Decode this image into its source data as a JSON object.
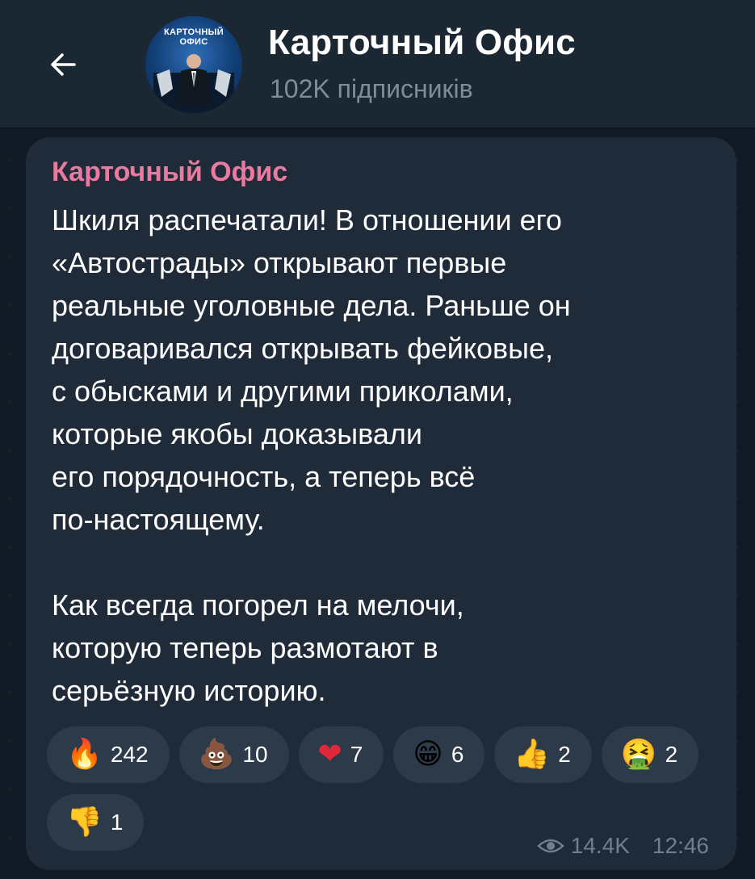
{
  "header": {
    "back_icon": "arrow-left-icon",
    "avatar_text_line1": "КАРТОЧНЫЙ",
    "avatar_text_line2": "ОФИС",
    "title": "Карточный Офис",
    "subtitle": "102K підписників"
  },
  "message": {
    "sender": "Карточный Офис",
    "text": "Шкиля распечатали! В отношении его\n«Автострады» открывают первые\nреальные уголовные дела. Раньше он\nдоговаривался открывать фейковые,\nс обысками и другими приколами,\nкоторые якобы доказывали\nего порядочность, а теперь всё\nпо-настоящему.\n\nКак всегда погорел на мелочи,\nкоторую теперь размотают в\nсерьёзную историю.",
    "reactions": [
      {
        "emoji": "🔥",
        "icon": "fire-emoji",
        "count": "242"
      },
      {
        "emoji": "💩",
        "icon": "poop-emoji",
        "count": "10"
      },
      {
        "emoji": "❤",
        "icon": "heart-emoji",
        "count": "7"
      },
      {
        "emoji": "😁",
        "icon": "grin-emoji",
        "count": "6"
      },
      {
        "emoji": "👍",
        "icon": "thumbs-up-emoji",
        "count": "2"
      },
      {
        "emoji": "🤮",
        "icon": "vomit-emoji",
        "count": "2"
      },
      {
        "emoji": "👎",
        "icon": "thumbs-down-emoji",
        "count": "1"
      }
    ],
    "views_icon": "eye-icon",
    "views": "14.4K",
    "time": "12:46"
  },
  "colors": {
    "background": "#0f1a24",
    "header": "#1b2733",
    "bubble": "#1f2b38",
    "sender": "#e97aa0",
    "reaction_chip": "#2c3a4a",
    "meta_text": "#6f7f8e"
  }
}
